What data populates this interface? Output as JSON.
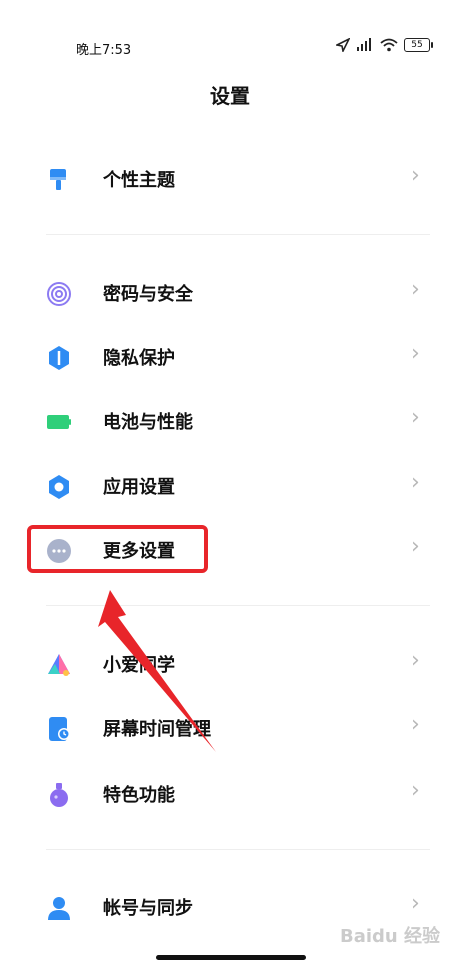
{
  "status_bar": {
    "time": "晚上7:53",
    "battery": "55",
    "icons": [
      "location-icon",
      "signal-icon",
      "wifi-icon",
      "battery-icon"
    ]
  },
  "header": {
    "title": "设置"
  },
  "settings": {
    "theme": {
      "label": "个性主题",
      "icon": "paintbrush-icon",
      "color": "#2f8cf3"
    },
    "password": {
      "label": "密码与安全",
      "icon": "fingerprint-icon",
      "color": "#8c7bf2"
    },
    "privacy": {
      "label": "隐私保护",
      "icon": "shield-icon",
      "color": "#2f8cf3"
    },
    "battery": {
      "label": "电池与性能",
      "icon": "battery-icon",
      "color": "#2fcf7a"
    },
    "apps": {
      "label": "应用设置",
      "icon": "gear-icon",
      "color": "#2f8cf3"
    },
    "more": {
      "label": "更多设置",
      "icon": "more-dots-icon",
      "color": "#a9b2cb"
    },
    "xiaoai": {
      "label": "小爱同学",
      "icon": "xiaoai-icon",
      "color": "#5a7cff"
    },
    "screen_time": {
      "label": "屏幕时间管理",
      "icon": "screen-time-icon",
      "color": "#2f8cf3"
    },
    "features": {
      "label": "特色功能",
      "icon": "flask-icon",
      "color": "#8b6cf0"
    },
    "account": {
      "label": "帐号与同步",
      "icon": "user-icon",
      "color": "#2f8cf3"
    }
  },
  "annotation": {
    "highlight_color": "#e8252a"
  },
  "watermark": {
    "text": "Baidu 经验"
  }
}
